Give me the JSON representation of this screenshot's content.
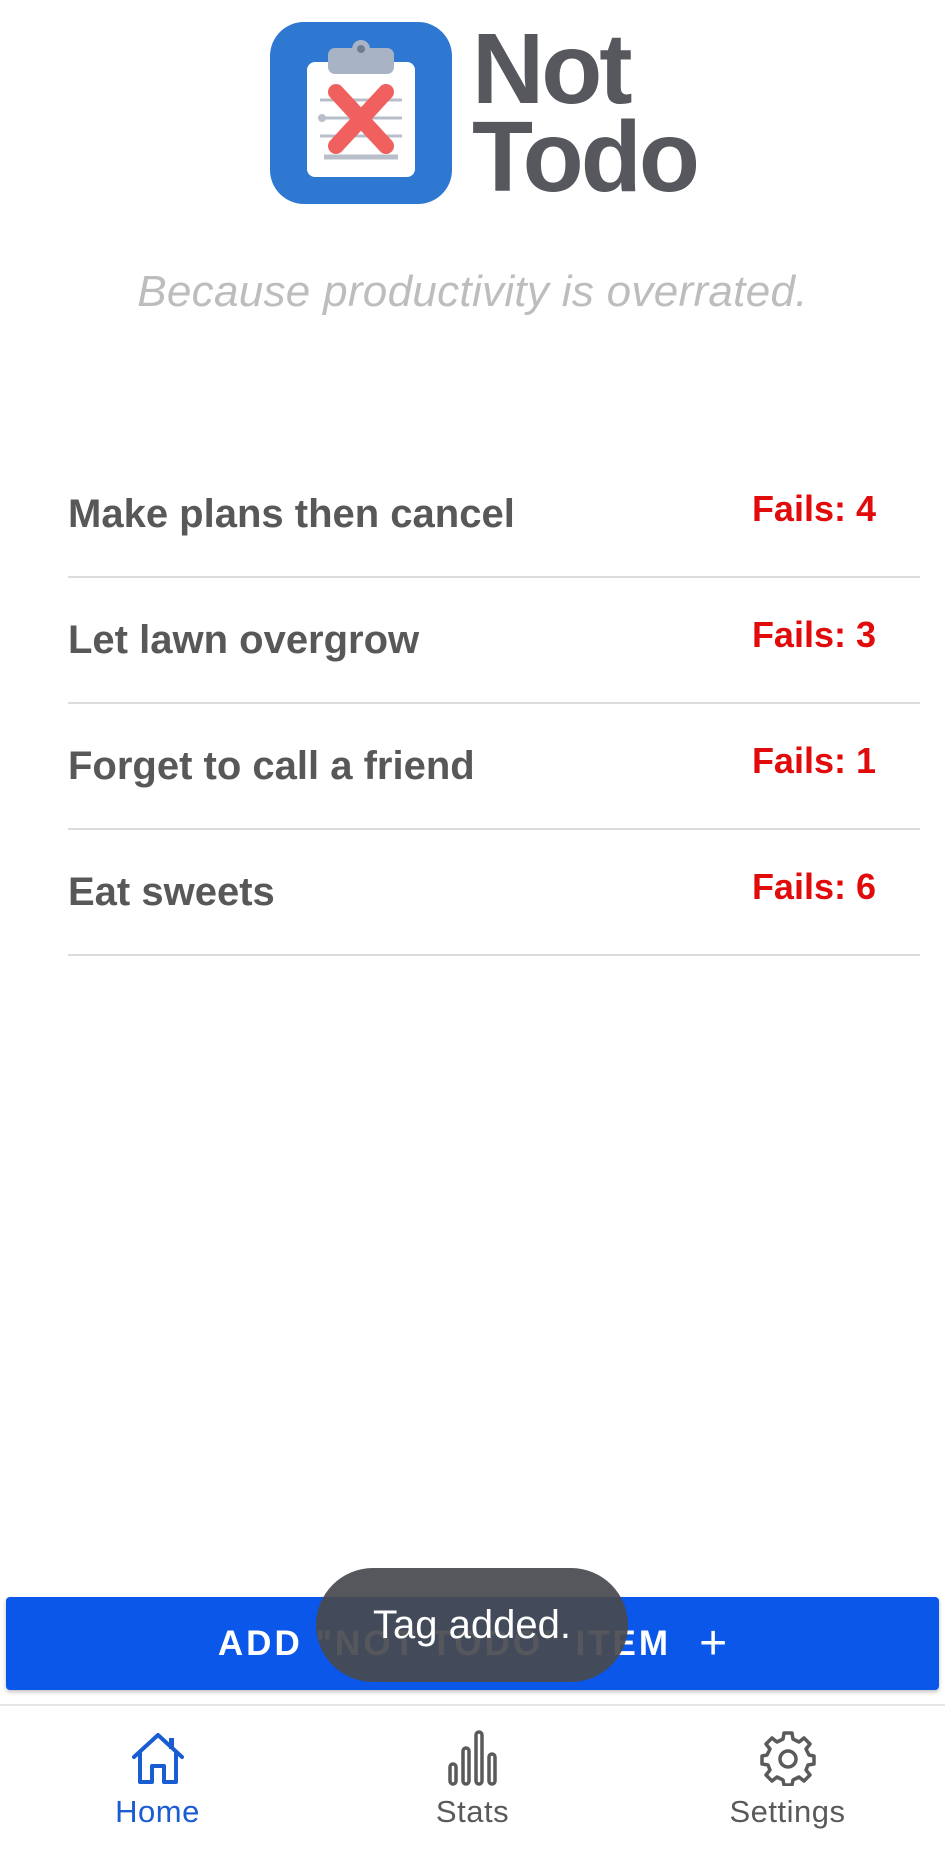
{
  "app": {
    "logo_line1": "Not",
    "logo_line2": "Todo",
    "tagline": "Because productivity is overrated."
  },
  "items": [
    {
      "label": "Make plans then cancel",
      "fails": "Fails: 4"
    },
    {
      "label": "Let lawn overgrow",
      "fails": "Fails: 3"
    },
    {
      "label": "Forget to call a friend",
      "fails": "Fails: 1"
    },
    {
      "label": "Eat sweets",
      "fails": "Fails: 6"
    }
  ],
  "add_button": {
    "label": "ADD \"NOT TODO\" ITEM",
    "icon": "plus-icon"
  },
  "toast": {
    "message": "Tag added."
  },
  "nav": {
    "home": {
      "label": "Home",
      "icon": "home-icon",
      "active": true
    },
    "stats": {
      "label": "Stats",
      "icon": "bar-chart-icon"
    },
    "settings": {
      "label": "Settings",
      "icon": "gear-icon"
    }
  },
  "colors": {
    "primary": "#0a57ea",
    "logo_blue": "#2f78d2",
    "fails_red": "#e10b0b",
    "active_nav": "#1a5cd1"
  }
}
